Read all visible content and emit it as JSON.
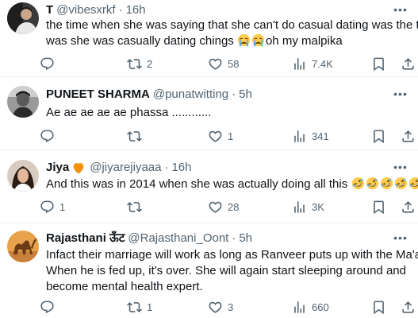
{
  "tweets": [
    {
      "name": "T",
      "handle": "@vibesxrkf",
      "separator": "·",
      "time": "16h",
      "text_line1": "the time when she was saying that she can't do casual dating was the time",
      "text_line2": "was she was casually dating chings",
      "text_line2_suffix": "oh my malpika",
      "emojis": [
        "crying-face",
        "crying-face"
      ],
      "replies": "",
      "reposts": "2",
      "likes": "58",
      "views": "7.4K"
    },
    {
      "name": "PUNEET SHARMA",
      "handle": "@punatwitting",
      "separator": "·",
      "time": "5h",
      "text_line1": "Ae ae ae ae ae phassa ............",
      "replies": "",
      "reposts": "",
      "likes": "1",
      "views": "341"
    },
    {
      "name": "Jiya",
      "name_badge": "orange-heart",
      "handle": "@jiyarejiyaaa",
      "separator": "·",
      "time": "16h",
      "text_line1": "And this was in 2014 when she was actually doing all this",
      "emojis": [
        "rofl",
        "rofl",
        "rofl",
        "rofl",
        "rofl"
      ],
      "replies": "1",
      "reposts": "",
      "likes": "28",
      "views": "3K"
    },
    {
      "name": "Rajasthani ऊँट",
      "handle": "@Rajasthani_Oont",
      "separator": "·",
      "time": "5h",
      "text_line1": "Infact their marriage will work as long as Ranveer puts up with the Ma'am.",
      "text_line2": "When he is fed up, it's over. She will again start sleeping around and",
      "text_line3": "become mental health expert.",
      "replies": "",
      "reposts": "1",
      "likes": "3",
      "views": "660"
    }
  ],
  "colors": {
    "text": "#0f1419",
    "secondary": "#536471",
    "divider": "#eff3f4",
    "orange_heart": "#f4900c"
  },
  "icons": {
    "reply": "reply-icon",
    "repost": "repost-icon",
    "like": "like-icon",
    "views": "views-icon",
    "bookmark": "bookmark-icon",
    "share": "share-icon",
    "more": "more-icon"
  }
}
